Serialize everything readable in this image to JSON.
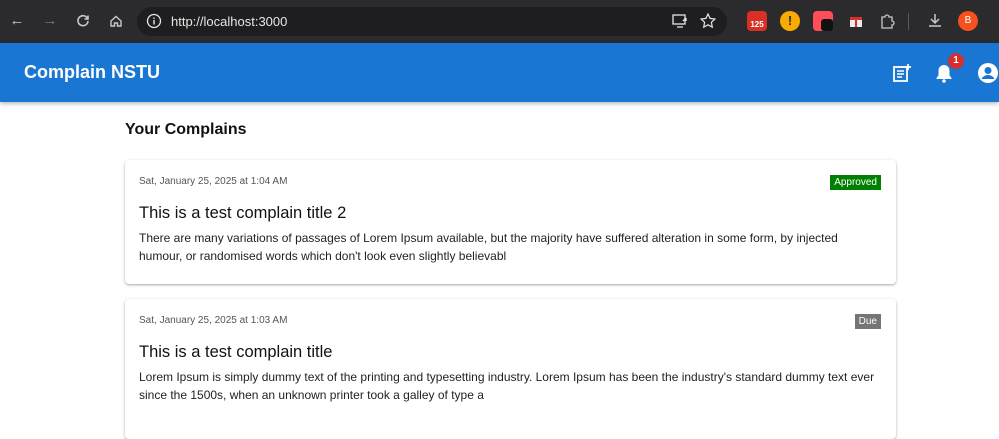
{
  "browser": {
    "url": "http://localhost:3000",
    "download_badge": "125",
    "profile_initial": "B"
  },
  "appbar": {
    "title": "Complain NSTU",
    "notification_count": "1"
  },
  "page": {
    "heading": "Your Complains"
  },
  "complaints": [
    {
      "date": "Sat, January 25, 2025 at 1:04 AM",
      "status": "Approved",
      "status_color": "#008000",
      "title": "This is a test complain title 2",
      "body": "There are many variations of passages of Lorem Ipsum available, but the majority have suffered alteration in some form, by injected humour, or randomised words which don't look even slightly believabl"
    },
    {
      "date": "Sat, January 25, 2025 at 1:03 AM",
      "status": "Due",
      "status_color": "#757575",
      "title": "This is a test complain title",
      "body": "Lorem Ipsum is simply dummy text of the printing and typesetting industry. Lorem Ipsum has been the industry's standard dummy text ever since the 1500s, when an unknown printer took a galley of type a"
    }
  ],
  "colors": {
    "primary": "#1976d2",
    "chrome_bg": "#2b2b2e",
    "badge_red": "#d32f2f"
  }
}
